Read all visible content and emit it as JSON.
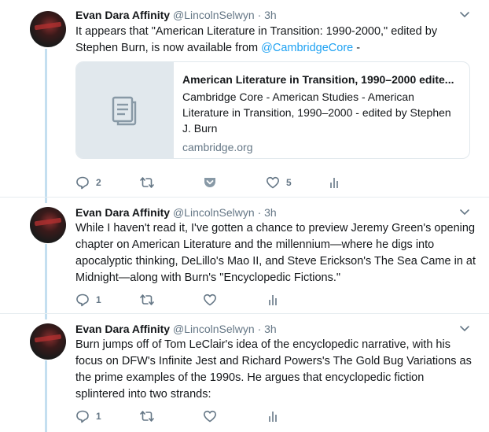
{
  "tweets": [
    {
      "name": "Evan Dara Affinity",
      "handle": "@LincolnSelwyn",
      "dot": "·",
      "time": "3h",
      "text_before": "It appears that \"American Literature in Transition: 1990-2000,\" edited by Stephen Burn, is now available from ",
      "mention": "@CambridgeCore",
      "text_after": " -",
      "card": {
        "title": "American Literature in Transition, 1990–2000 edite...",
        "description": "Cambridge Core - American Studies - American Literature in Transition, 1990–2000 - edited by Stephen J. Burn",
        "domain": "cambridge.org",
        "thumb_icon": "document-icon"
      },
      "replies": "2",
      "retweets": "",
      "likes": "5"
    },
    {
      "name": "Evan Dara Affinity",
      "handle": "@LincolnSelwyn",
      "dot": "·",
      "time": "3h",
      "text": "While I haven't read it, I've gotten a chance to preview Jeremy Green's opening chapter on American Literature and the millennium—where he digs into apocalyptic thinking, DeLillo's Mao II, and Steve Erickson's The Sea Came in at Midnight—along with Burn's \"Encyclopedic Fictions.\"",
      "replies": "1",
      "retweets": "",
      "likes": ""
    },
    {
      "name": "Evan Dara Affinity",
      "handle": "@LincolnSelwyn",
      "dot": "·",
      "time": "3h",
      "text": "Burn jumps off of Tom LeClair's idea of the encyclopedic narrative, with his focus on DFW's Infinite Jest and Richard Powers's The Gold Bug Variations as the prime examples of the 1990s. He argues that encyclopedic fiction splintered into two strands:",
      "replies": "1",
      "retweets": "",
      "likes": ""
    }
  ],
  "colors": {
    "link": "#1da1f2",
    "muted": "#657786",
    "thread_line": "#c4dff0"
  }
}
